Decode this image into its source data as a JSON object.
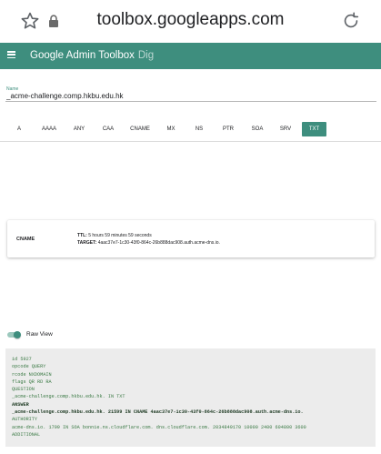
{
  "browser": {
    "url": "toolbox.googleapps.com"
  },
  "header": {
    "app_name": "Google Admin Toolbox",
    "tool_name": "Dig"
  },
  "name_field": {
    "label": "Name",
    "value": "_acme-challenge.comp.hkbu.edu.hk"
  },
  "record_types": [
    {
      "label": "A"
    },
    {
      "label": "AAAA"
    },
    {
      "label": "ANY"
    },
    {
      "label": "CAA"
    },
    {
      "label": "CNAME"
    },
    {
      "label": "MX"
    },
    {
      "label": "NS"
    },
    {
      "label": "PTR"
    },
    {
      "label": "SOA"
    },
    {
      "label": "SRV"
    },
    {
      "label": "TXT"
    }
  ],
  "selected_record_type": "TXT",
  "result": {
    "type": "CNAME",
    "ttl_label": "TTL:",
    "ttl_value": "5 hours 59 minutes 59 seconds",
    "target_label": "TARGET:",
    "target_value": "4aac37e7-1c30-43f0-864c-26b888dac908.auth.acme-dns.io."
  },
  "raw_view": {
    "label": "Raw View",
    "enabled": true,
    "lines": [
      {
        "text": "id 5927",
        "strong": false
      },
      {
        "text": "opcode QUERY",
        "strong": false
      },
      {
        "text": "rcode NXDOMAIN",
        "strong": false
      },
      {
        "text": "flags QR RD RA",
        "strong": false
      },
      {
        "text": "QUESTION",
        "strong": false
      },
      {
        "text": "_acme-challenge.comp.hkbu.edu.hk. IN TXT",
        "strong": false
      },
      {
        "text": "ANSWER",
        "strong": true
      },
      {
        "text": "_acme-challenge.comp.hkbu.edu.hk. 21599 IN CNAME 4aac37e7-1c30-43f0-864c-26b888dac908.auth.acme-dns.io.",
        "strong": true
      },
      {
        "text": "AUTHORITY",
        "strong": false
      },
      {
        "text": "acme-dns.io. 1799 IN SOA bonnie.ns.cloudflare.com. dns.cloudflare.com. 2034849170 10000 2400 604800 3600",
        "strong": false
      },
      {
        "text": "ADDITIONAL",
        "strong": false
      }
    ]
  },
  "colors": {
    "accent": "#3e8e7e",
    "raw_text": "#3b7a45",
    "raw_background": "#ececec"
  }
}
